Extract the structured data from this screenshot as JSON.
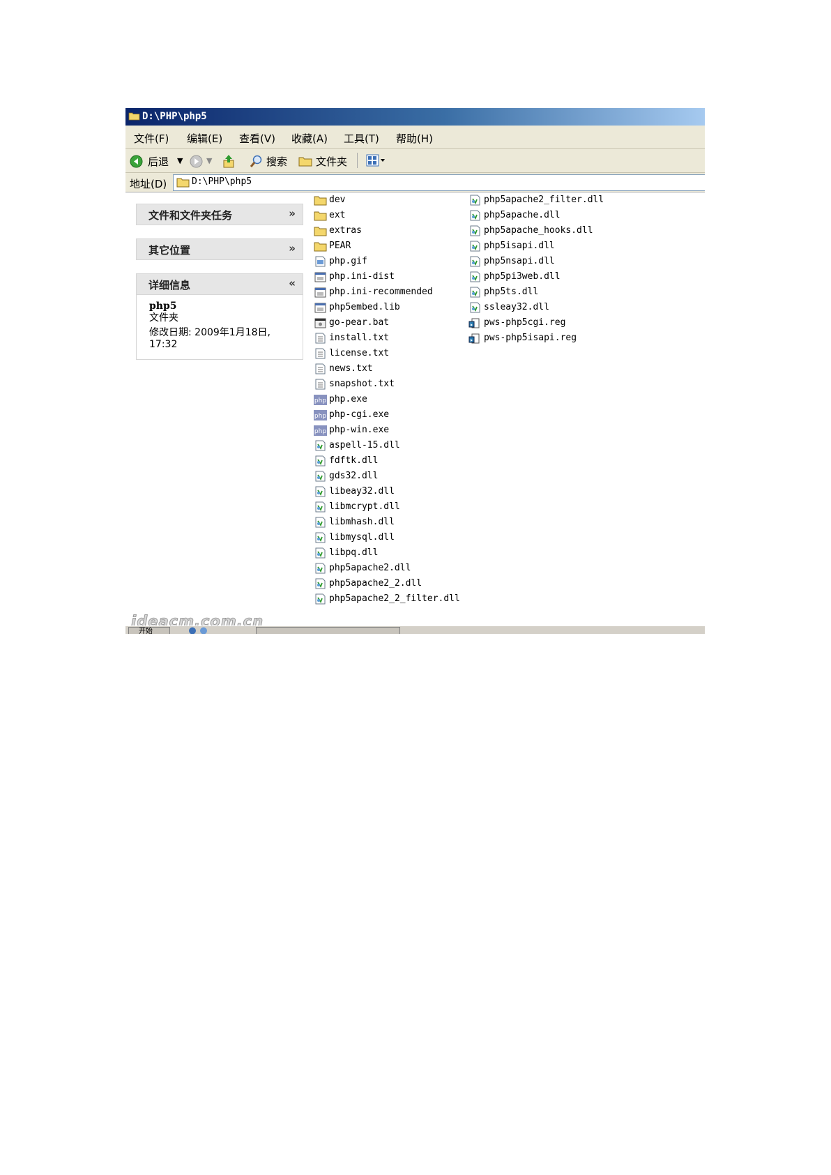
{
  "window": {
    "title": "D:\\PHP\\php5"
  },
  "menu": {
    "items": [
      "文件(F)",
      "编辑(E)",
      "查看(V)",
      "收藏(A)",
      "工具(T)",
      "帮助(H)"
    ]
  },
  "toolbar": {
    "back": "后退",
    "search": "搜索",
    "folders": "文件夹"
  },
  "address": {
    "label": "地址(D)",
    "value": "D:\\PHP\\php5"
  },
  "sidebar": {
    "tasks": "文件和文件夹任务",
    "other": "其它位置",
    "details": {
      "title": "详细信息",
      "name": "php5",
      "type": "文件夹",
      "modified_label": "修改日期:",
      "modified_value": "2009年1月18日,",
      "modified_time": "17:32"
    }
  },
  "files": {
    "col1": [
      {
        "name": "dev",
        "icon": "folder-icon"
      },
      {
        "name": "ext",
        "icon": "folder-icon"
      },
      {
        "name": "extras",
        "icon": "folder-icon"
      },
      {
        "name": "PEAR",
        "icon": "folder-icon"
      },
      {
        "name": "php.gif",
        "icon": "image-file-icon"
      },
      {
        "name": "php.ini-dist",
        "icon": "settings-file-icon"
      },
      {
        "name": "php.ini-recommended",
        "icon": "settings-file-icon"
      },
      {
        "name": "php5embed.lib",
        "icon": "settings-file-icon"
      },
      {
        "name": "go-pear.bat",
        "icon": "batch-file-icon"
      },
      {
        "name": "install.txt",
        "icon": "text-file-icon"
      },
      {
        "name": "license.txt",
        "icon": "text-file-icon"
      },
      {
        "name": "news.txt",
        "icon": "text-file-icon"
      },
      {
        "name": "snapshot.txt",
        "icon": "text-file-icon"
      },
      {
        "name": "php.exe",
        "icon": "php-exe-icon"
      },
      {
        "name": "php-cgi.exe",
        "icon": "php-exe-icon"
      },
      {
        "name": "php-win.exe",
        "icon": "php-exe-icon"
      },
      {
        "name": "aspell-15.dll",
        "icon": "dll-file-icon"
      },
      {
        "name": "fdftk.dll",
        "icon": "dll-file-icon"
      },
      {
        "name": "gds32.dll",
        "icon": "dll-file-icon"
      },
      {
        "name": "libeay32.dll",
        "icon": "dll-file-icon"
      },
      {
        "name": "libmcrypt.dll",
        "icon": "dll-file-icon"
      },
      {
        "name": "libmhash.dll",
        "icon": "dll-file-icon"
      },
      {
        "name": "libmysql.dll",
        "icon": "dll-file-icon"
      },
      {
        "name": "libpq.dll",
        "icon": "dll-file-icon"
      },
      {
        "name": "php5apache2.dll",
        "icon": "dll-file-icon"
      },
      {
        "name": "php5apache2_2.dll",
        "icon": "dll-file-icon"
      },
      {
        "name": "php5apache2_2_filter.dll",
        "icon": "dll-file-icon"
      }
    ],
    "col2": [
      {
        "name": "php5apache2_filter.dll",
        "icon": "dll-file-icon"
      },
      {
        "name": "php5apache.dll",
        "icon": "dll-file-icon"
      },
      {
        "name": "php5apache_hooks.dll",
        "icon": "dll-file-icon"
      },
      {
        "name": "php5isapi.dll",
        "icon": "dll-file-icon"
      },
      {
        "name": "php5nsapi.dll",
        "icon": "dll-file-icon"
      },
      {
        "name": "php5pi3web.dll",
        "icon": "dll-file-icon"
      },
      {
        "name": "php5ts.dll",
        "icon": "dll-file-icon"
      },
      {
        "name": "ssleay32.dll",
        "icon": "dll-file-icon"
      },
      {
        "name": "pws-php5cgi.reg",
        "icon": "registry-file-icon"
      },
      {
        "name": "pws-php5isapi.reg",
        "icon": "registry-file-icon"
      }
    ]
  },
  "watermark": "ideacm.com.cn",
  "taskbar": {
    "start": "开始"
  }
}
